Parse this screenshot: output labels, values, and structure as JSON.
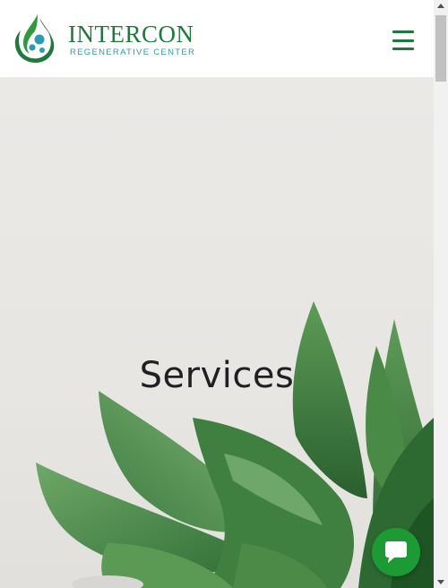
{
  "header": {
    "brand_name": "INTERCON",
    "brand_sub": "REGENERATIVE CENTER",
    "menu_icon": "hamburger-menu-icon"
  },
  "hero": {
    "title": "Services",
    "image": "succulent-plant-photo"
  },
  "chat": {
    "icon": "chat-bubble-icon"
  },
  "colors": {
    "brand_green": "#1d7a3a",
    "brand_teal": "#2a9bb5",
    "chat_green": "#1c9a34",
    "hero_bg": "#ebe9e6"
  }
}
